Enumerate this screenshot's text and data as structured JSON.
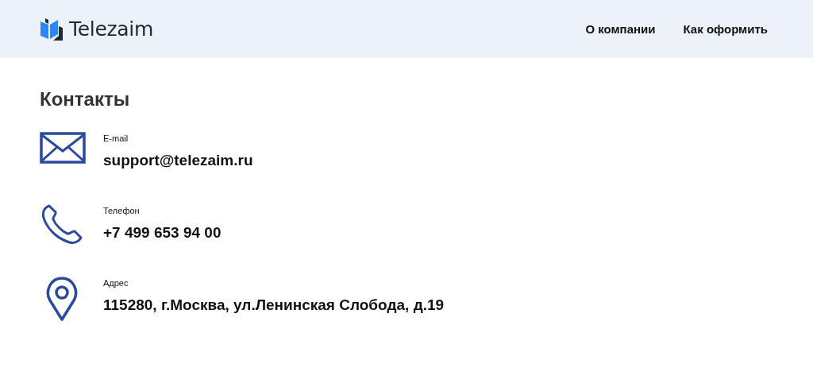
{
  "header": {
    "logo_text": "Telezaim",
    "nav": [
      "О компании",
      "Как оформить"
    ]
  },
  "title": "Контакты",
  "contacts": [
    {
      "kind": "email",
      "label": "E-mail",
      "value": "support@telezaim.ru"
    },
    {
      "kind": "phone",
      "label": "Телефон",
      "value": "+7 499 653 94 00"
    },
    {
      "kind": "address",
      "label": "Адрес",
      "value": "115280, г.Москва, ул.Ленинская Слобода, д.19"
    }
  ]
}
